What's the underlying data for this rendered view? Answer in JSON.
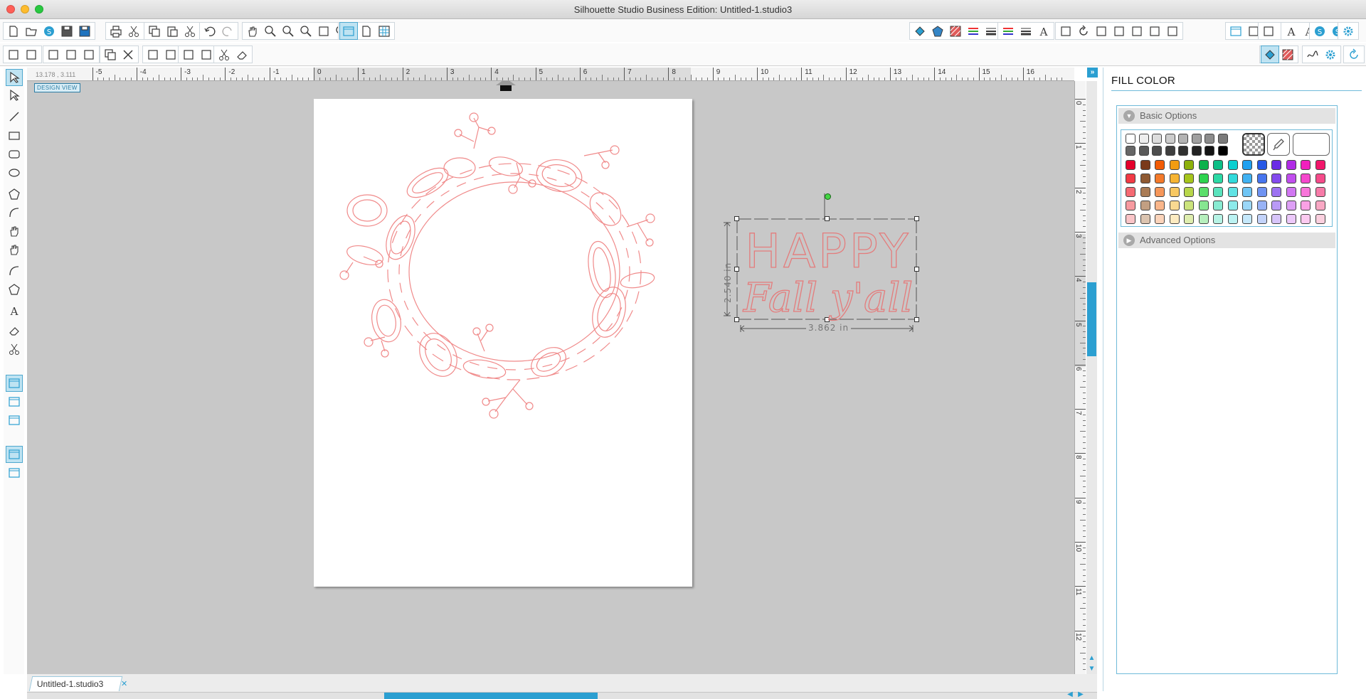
{
  "window": {
    "title": "Silhouette Studio Business Edition: Untitled-1.studio3",
    "traffic_lights": [
      "#ff5f57",
      "#febc2e",
      "#28c840"
    ]
  },
  "toolbar_top": {
    "groups": [
      [
        "new-file-icon",
        "open-folder-icon",
        "open-library-icon",
        "save-icon",
        "save-as-icon"
      ],
      [
        "print-icon",
        "print-cut-icon"
      ],
      [
        "copy-icon",
        "paste-icon",
        "cut-icon"
      ],
      [
        "undo-icon",
        "redo-icon"
      ],
      [
        "pan-hand-icon",
        "zoom-in-icon",
        "zoom-out-icon",
        "zoom-box-icon",
        "fit-to-window-icon",
        "zoom-to-page-icon"
      ],
      [
        "draw-panel-icon",
        "page-setup-icon",
        "grid-icon"
      ],
      [
        "fill-color-icon",
        "fill-gradient-icon",
        "fill-pattern-icon",
        "line-color-icon",
        "line-style-icon"
      ],
      [
        "line-color-2-icon",
        "line-width-icon",
        "text-style-icon"
      ],
      [
        "transform-icon",
        "rotate-icon",
        "scale-icon",
        "shear-icon",
        "mirror-icon",
        "offset-icon",
        "trace-icon"
      ],
      [
        "align-panel-icon",
        "replicate-icon"
      ],
      [
        "media-icon",
        "send-icon"
      ],
      [
        "text-icon",
        "text-format-icon",
        "grid-panel-icon"
      ],
      [
        "library-icon",
        "store-icon"
      ],
      [
        "settings-gear-icon"
      ]
    ]
  },
  "toolbar_second": {
    "groups": [
      [
        "select-all-icon",
        "deselect-icon"
      ],
      [
        "group-icon",
        "ungroup-icon",
        "compound-path-icon"
      ],
      [
        "duplicate-icon",
        "delete-icon"
      ],
      [
        "bring-front-icon",
        "send-back-icon"
      ],
      [
        "weld-icon",
        "offset-ring-icon"
      ],
      [
        "knife-icon",
        "eraser-panel-icon"
      ],
      [
        "fill-panel-icon",
        "fill-pattern-panel-icon"
      ],
      [
        "sketch-icon",
        "cut-settings-icon"
      ],
      [
        "refresh-icon"
      ]
    ]
  },
  "left_tools": [
    "select-pointer-icon",
    "edit-points-icon",
    "line-tool-icon",
    "rectangle-tool-icon",
    "rounded-rect-tool-icon",
    "ellipse-tool-icon",
    "polygon-tool-icon",
    "curve-tool-icon",
    "freehand-tool-icon",
    "smooth-freehand-tool-icon",
    "arc-tool-icon",
    "regular-polygon-tool-icon",
    "text-tool-icon",
    "eraser-tool-icon",
    "knife-tool-icon",
    "design-view-icon",
    "library-view-icon",
    "store-view-icon",
    "single-panel-icon",
    "split-panel-icon"
  ],
  "ruler": {
    "coords": "13.178 , 3.111",
    "h_numbers": [
      "-5",
      "-4",
      "-3",
      "-2",
      "-1",
      "0",
      "1",
      "2",
      "3",
      "4",
      "5",
      "6",
      "7",
      "8",
      "9",
      "10",
      "11",
      "12",
      "13",
      "14",
      "15",
      "16"
    ],
    "v_numbers": [
      "0",
      "1",
      "2",
      "3",
      "4",
      "5",
      "6",
      "7",
      "8",
      "9",
      "10",
      "11",
      "12"
    ]
  },
  "canvas": {
    "design_view_label": "DESIGN VIEW",
    "background": "#c8c8c8",
    "stroke_color": "#f08a8a",
    "text_line1": "HAPPY",
    "text_line2": "Fall y'all",
    "height_label": "2.540 in",
    "width_label": "3.862 in"
  },
  "document_tab": {
    "label": "Untitled-1.studio3",
    "close_glyph": "✕"
  },
  "fill_panel": {
    "title": "FILL COLOR",
    "basic_label": "Basic Options",
    "advanced_label": "Advanced Options",
    "accent": "#2b9fd1",
    "gray_row1": [
      "#ffffff",
      "#eeeeee",
      "#dddddd",
      "#cccccc",
      "#b3b3b3",
      "#a0a0a0",
      "#8c8c8c",
      "#7a7a7a"
    ],
    "gray_row2": [
      "#666666",
      "#595959",
      "#4d4d4d",
      "#3f3f3f",
      "#303030",
      "#222222",
      "#141414",
      "#000000"
    ],
    "color_rows": [
      [
        "#e4002b",
        "#7a3a1a",
        "#f25c05",
        "#f29c11",
        "#8db10b",
        "#0bb14b",
        "#0dbf86",
        "#0bcfd0",
        "#1fa0f0",
        "#2759e6",
        "#6b2ce6",
        "#b12ce6",
        "#f21fbe",
        "#f2176b"
      ],
      [
        "#f23a45",
        "#8f5a33",
        "#f47a2a",
        "#f6b433",
        "#a6c51c",
        "#2ed34f",
        "#2cd9a5",
        "#31dadb",
        "#41b2f2",
        "#4775ee",
        "#844bee",
        "#c14eee",
        "#f548cd",
        "#f54b8a"
      ],
      [
        "#f56a73",
        "#a97b55",
        "#f6975a",
        "#f8c862",
        "#b8d64a",
        "#5ade6a",
        "#5ae3bd",
        "#60e3e4",
        "#6fc5f5",
        "#6f93f2",
        "#9d72f2",
        "#d177f2",
        "#f875da",
        "#f77ba8"
      ],
      [
        "#f79aa0",
        "#c29f82",
        "#f9b68b",
        "#f9d991",
        "#cbe37c",
        "#86e691",
        "#88ebd2",
        "#8ceaea",
        "#9bd7f8",
        "#98b3f6",
        "#b99af6",
        "#dea0f6",
        "#faa1e5",
        "#f9a8c4"
      ],
      [
        "#fac5c8",
        "#dbc4b0",
        "#fbd4bb",
        "#fcebc1",
        "#dfeeaf",
        "#b6efbd",
        "#b6f3e5",
        "#bbf2f2",
        "#c5e8fb",
        "#c3d3fa",
        "#d7c5fa",
        "#ecc9fa",
        "#fccaf0",
        "#fbd0df"
      ]
    ]
  }
}
